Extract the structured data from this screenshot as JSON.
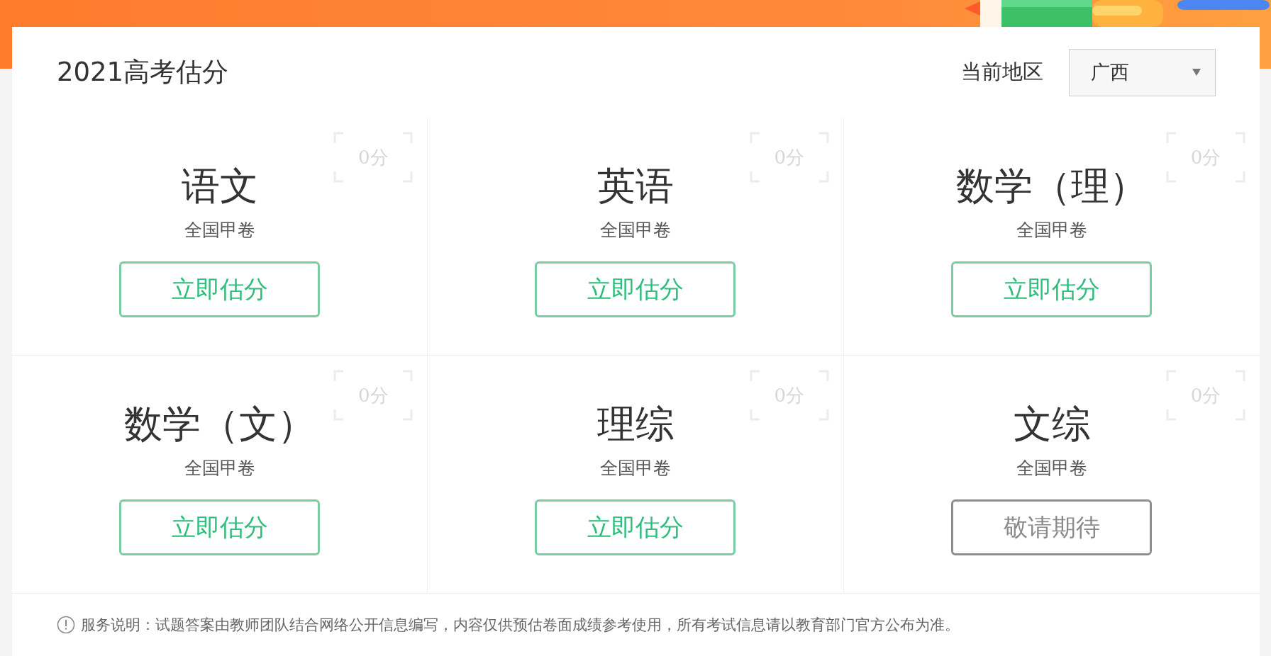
{
  "header": {
    "title": "2021高考估分",
    "region_label": "当前地区",
    "region_select": {
      "value": "广西"
    }
  },
  "subjects": [
    {
      "name": "语文",
      "paper": "全国甲卷",
      "score": "0分",
      "action": "立即估分",
      "available": true
    },
    {
      "name": "英语",
      "paper": "全国甲卷",
      "score": "0分",
      "action": "立即估分",
      "available": true
    },
    {
      "name": "数学（理）",
      "paper": "全国甲卷",
      "score": "0分",
      "action": "立即估分",
      "available": true
    },
    {
      "name": "数学（文）",
      "paper": "全国甲卷",
      "score": "0分",
      "action": "立即估分",
      "available": true
    },
    {
      "name": "理综",
      "paper": "全国甲卷",
      "score": "0分",
      "action": "立即估分",
      "available": true
    },
    {
      "name": "文综",
      "paper": "全国甲卷",
      "score": "0分",
      "action": "敬请期待",
      "available": false
    }
  ],
  "notice": "服务说明：试题答案由教师团队结合网络公开信息编写，内容仅供预估卷面成绩参考使用，所有考试信息请以教育部门官方公布为准。"
}
